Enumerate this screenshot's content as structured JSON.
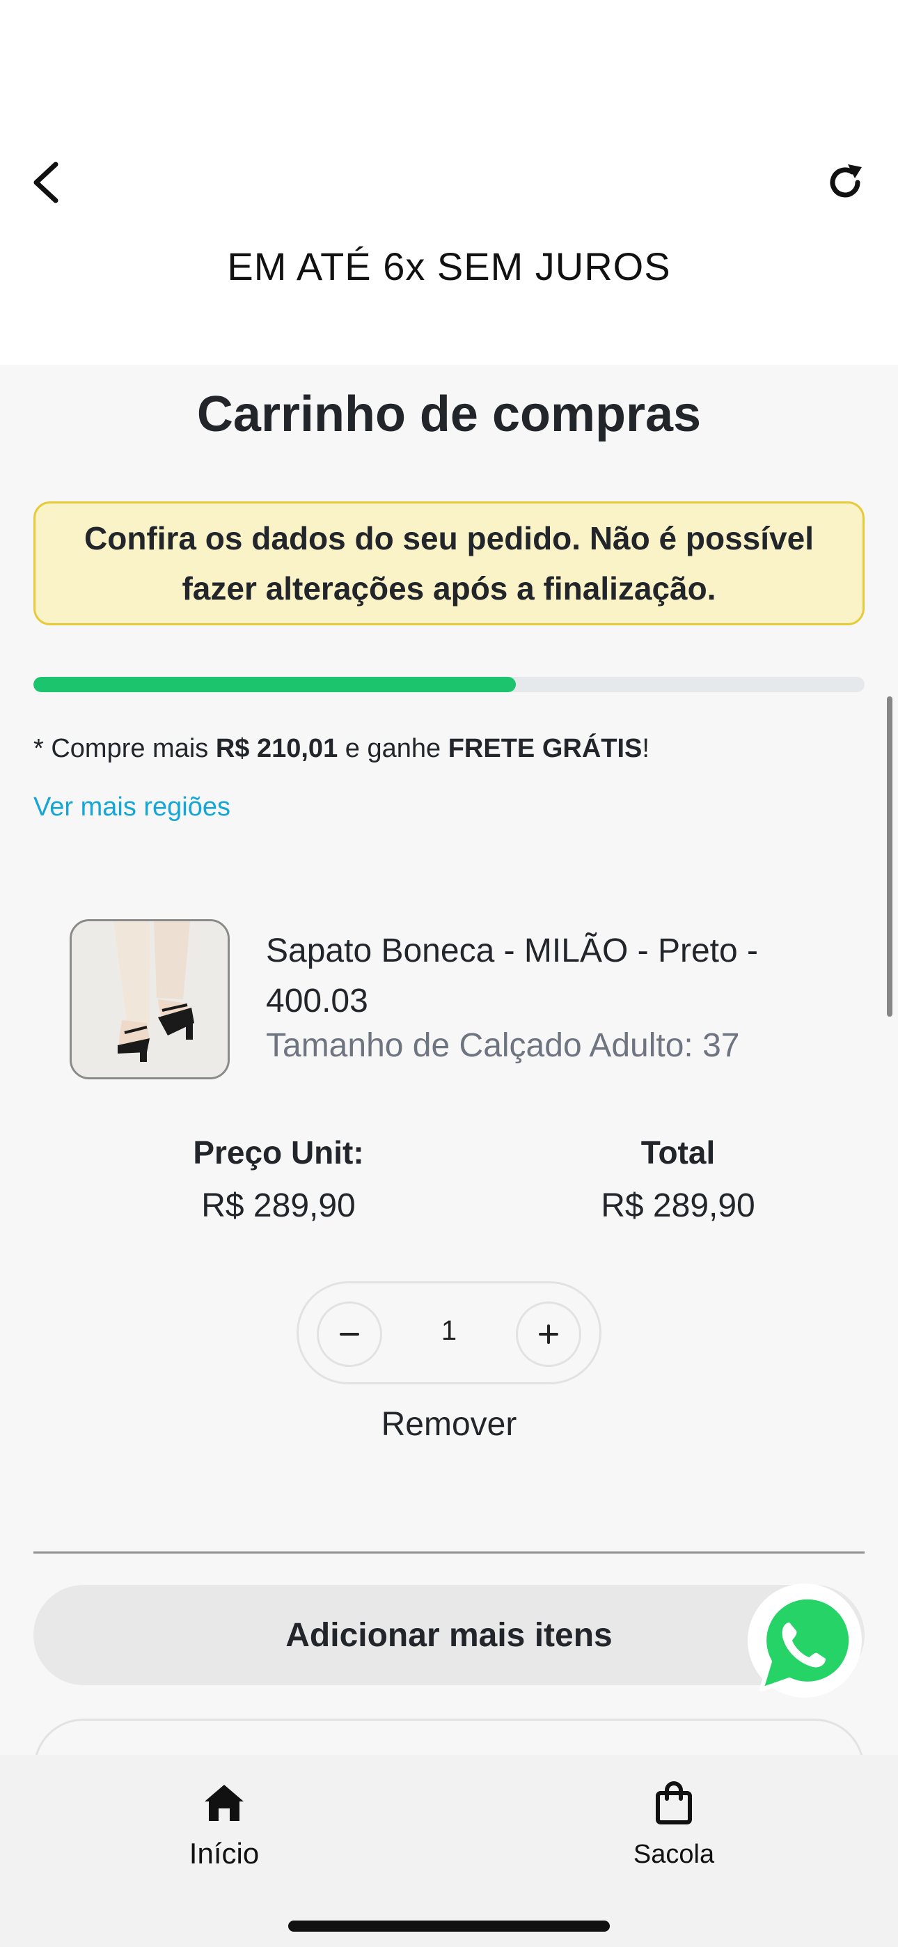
{
  "header": {
    "promo_text": "EM ATÉ 6x SEM JUROS",
    "back_icon": "chevron-left-icon",
    "refresh_icon": "refresh-icon"
  },
  "cart": {
    "title": "Carrinho de compras",
    "notice": "Confira os dados do seu pedido. Não é possível fazer alterações após a finalização.",
    "free_shipping_progress": 0.58,
    "shipping": {
      "prefix": "* Compre mais ",
      "amount": "R$ 210,01",
      "middle": " e ganhe ",
      "highlight": "FRETE GRÁTIS",
      "suffix": "!"
    },
    "more_regions_link": "Ver mais regiões"
  },
  "item": {
    "name": "Sapato Boneca - MILÃO - Preto - 400.03",
    "variant": "Tamanho de Calçado Adulto: 37",
    "unit_price_label": "Preço Unit:",
    "unit_price": "R$ 289,90",
    "total_label": "Total",
    "total": "R$ 289,90",
    "quantity": "1",
    "remove_label": "Remover"
  },
  "actions": {
    "add_more_label": "Adicionar mais itens"
  },
  "nav": {
    "home_label": "Início",
    "bag_label": "Sacola"
  },
  "colors": {
    "progress_fill": "#1cc46d",
    "notice_bg": "#faf3c8",
    "notice_border": "#e8c93a",
    "link": "#15a6d8",
    "whatsapp": "#25d366"
  }
}
